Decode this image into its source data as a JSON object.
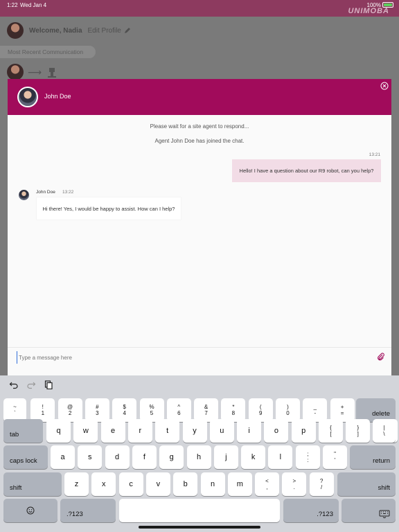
{
  "status_bar": {
    "time": "1:22",
    "date": "Wed Jan 4",
    "battery": "100%"
  },
  "app": {
    "brand": "UNIMOBA",
    "welcome": "Welcome, Nadia",
    "edit_profile": "Edit Profile",
    "recent_section": "Most Recent Communication"
  },
  "chat": {
    "agent_name": "John Doe",
    "system_messages": [
      "Please wait for a site agent to respond...",
      "Agent John Doe has joined the chat."
    ],
    "outgoing": {
      "time": "13:21",
      "text": "Hello! I have a question about our R9 robot, can you help?"
    },
    "incoming": {
      "sender": "John Doe",
      "time": "13:22",
      "text": "Hi there! Yes, I would be happy to assist. How can I help?"
    },
    "input_placeholder": "Type a message here"
  },
  "keyboard": {
    "row1": [
      [
        "~",
        "`"
      ],
      [
        "!",
        "1"
      ],
      [
        "@",
        "2"
      ],
      [
        "#",
        "3"
      ],
      [
        "$",
        "4"
      ],
      [
        "%",
        "5"
      ],
      [
        "^",
        "6"
      ],
      [
        "&",
        "7"
      ],
      [
        "*",
        "8"
      ],
      [
        "(",
        "9"
      ],
      [
        ")",
        "0"
      ],
      [
        "_",
        "-"
      ],
      [
        "+",
        "="
      ]
    ],
    "delete": "delete",
    "tab": "tab",
    "row2": [
      "q",
      "w",
      "e",
      "r",
      "t",
      "y",
      "u",
      "i",
      "o",
      "p"
    ],
    "row2_extra": [
      [
        "{",
        "["
      ],
      [
        "}",
        "]"
      ],
      [
        "|",
        "\\"
      ]
    ],
    "caps": "caps lock",
    "row3": [
      "a",
      "s",
      "d",
      "f",
      "g",
      "h",
      "j",
      "k",
      "l"
    ],
    "row3_extra": [
      [
        ";",
        ":"
      ],
      [
        "\"",
        "'"
      ]
    ],
    "return": "return",
    "shift": "shift",
    "row4": [
      "z",
      "x",
      "c",
      "v",
      "b",
      "n",
      "m"
    ],
    "row4_extra": [
      [
        "<",
        ","
      ],
      [
        ">",
        "."
      ],
      [
        "?",
        "/"
      ]
    ],
    "numbers": ".?123",
    "emoji_icon": "emoji-icon",
    "dismiss_icon": "keyboard-dismiss-icon"
  }
}
